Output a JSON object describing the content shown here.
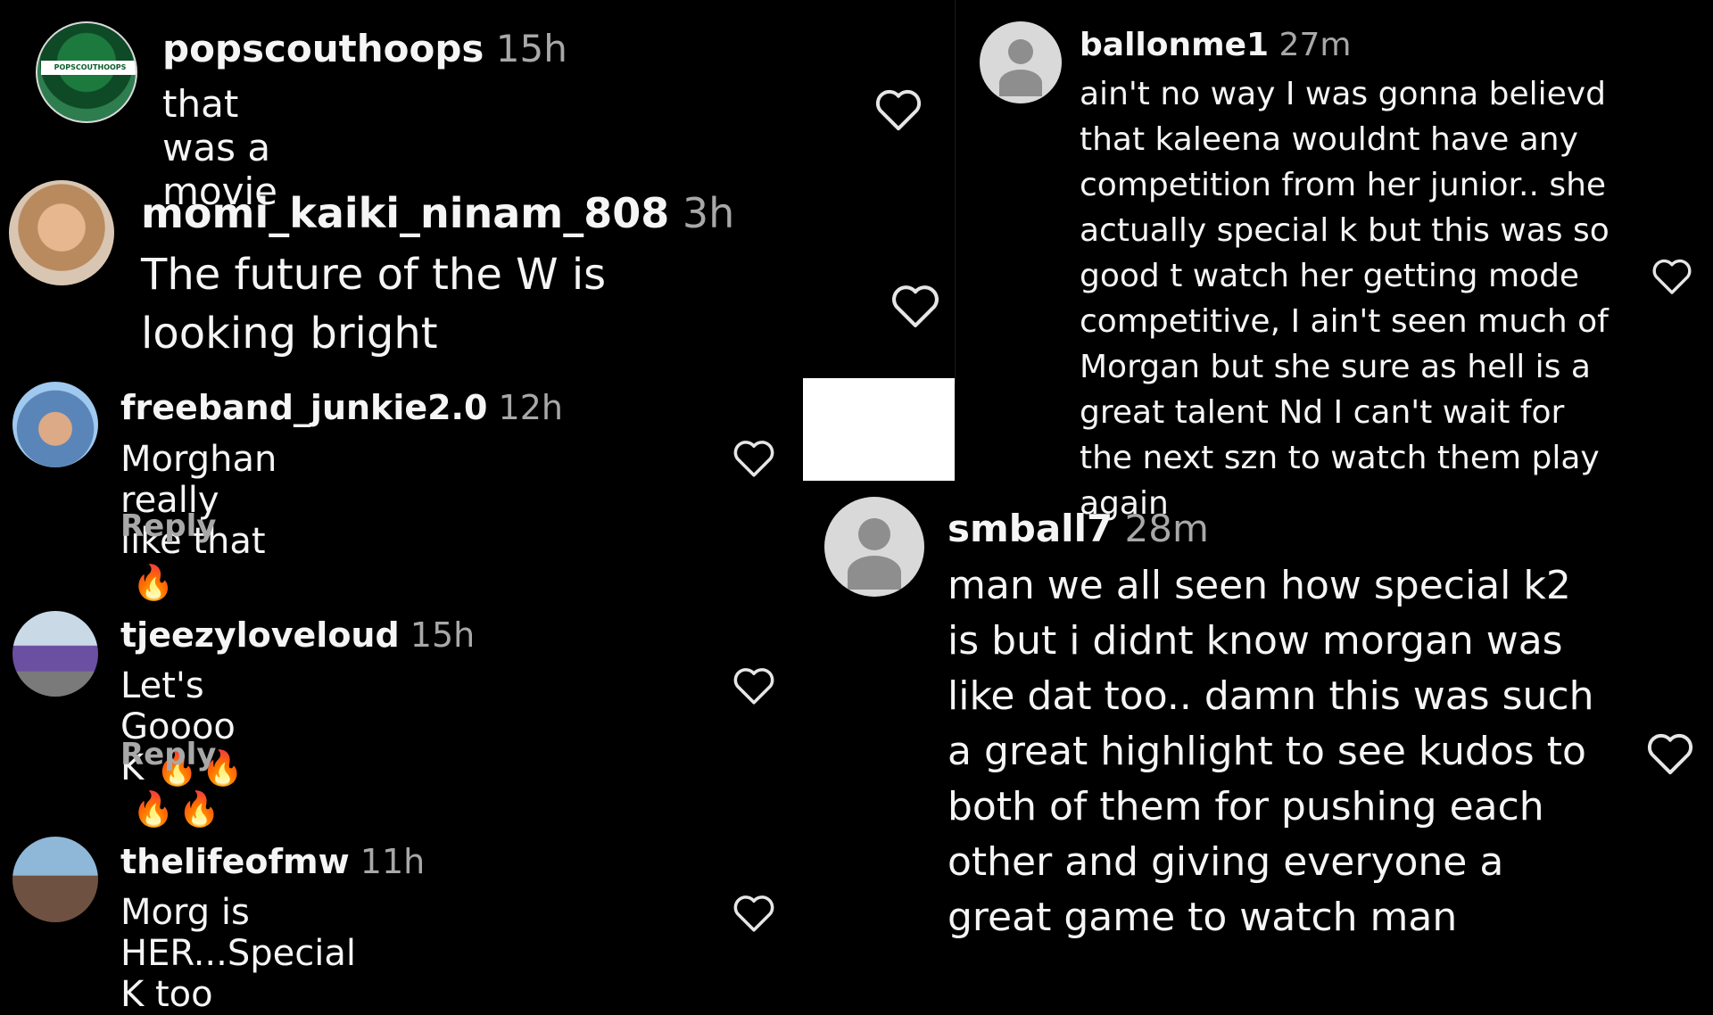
{
  "fire_glyph": "🔥",
  "reply_label": "Reply",
  "colors": {
    "background": "#000000",
    "text": "#f5f5f5",
    "muted": "#a8a8a8"
  },
  "left": {
    "comments": [
      {
        "username": "popscouthoops",
        "time": "15h",
        "text": "that was a movie",
        "avatar_text": "POPSCOUTHOOPS"
      },
      {
        "username": "momi_kaiki_ninam_808",
        "time": "3h",
        "text": "The future of the W is looking bright"
      },
      {
        "username": "freeband_junkie2.0",
        "time": "12h",
        "text": "Morghan really like that"
      },
      {
        "username": "tjeezyloveloud",
        "time": "15h",
        "text": "Let's Goooo K"
      },
      {
        "username": "thelifeofmw",
        "time": "11h",
        "text": "Morg is HER...Special K too"
      }
    ]
  },
  "right": {
    "comments": [
      {
        "username": "ballonme1",
        "time": "27m",
        "text": "ain't no way I was gonna believd that kaleena wouldnt have any competition from her junior.. she actually special k but this was so good t watch her getting mode competitive, I ain't seen much of Morgan but she sure as hell is a great talent Nd I can't wait for the next szn to watch them play again"
      },
      {
        "username": "smball7",
        "time": "28m",
        "text": "man we all seen how special k2 is but i didnt know morgan was like dat too.. damn this was such a great highlight to see kudos to both of them for pushing each other and giving everyone a great game to watch man"
      }
    ]
  }
}
